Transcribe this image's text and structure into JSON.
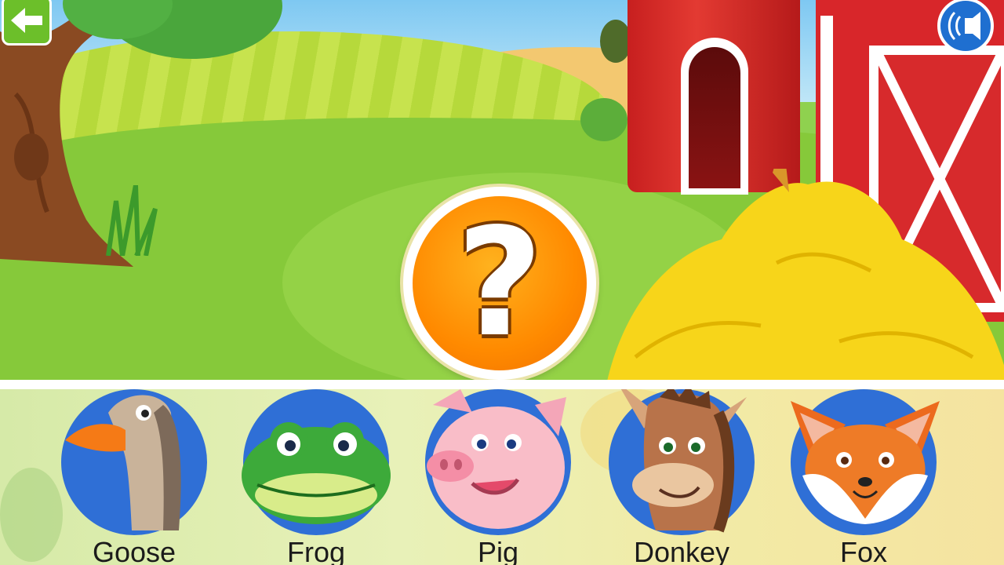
{
  "navigation": {
    "back_icon": "arrow-left-icon",
    "sound_icon": "speaker-icon"
  },
  "question": {
    "mark": "?"
  },
  "animals": [
    {
      "id": "goose",
      "label": "Goose"
    },
    {
      "id": "frog",
      "label": "Frog"
    },
    {
      "id": "pig",
      "label": "Pig"
    },
    {
      "id": "donkey",
      "label": "Donkey"
    },
    {
      "id": "fox",
      "label": "Fox"
    }
  ],
  "colors": {
    "disc": "#2f6fd6",
    "question_orange": "#ff8a00",
    "barn_red": "#d8262a",
    "back_green": "#6cbf2a"
  }
}
